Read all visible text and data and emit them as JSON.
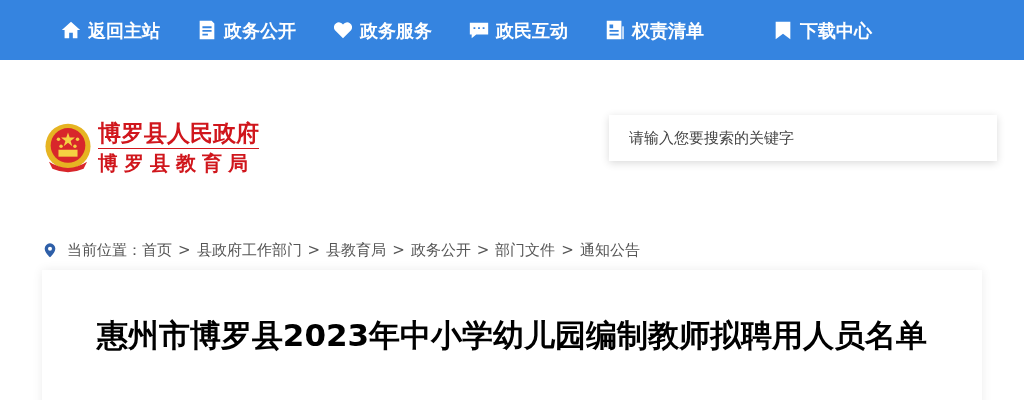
{
  "nav": [
    {
      "label": "返回主站"
    },
    {
      "label": "政务公开"
    },
    {
      "label": "政务服务"
    },
    {
      "label": "政民互动"
    },
    {
      "label": "权责清单"
    },
    {
      "label": "下载中心"
    }
  ],
  "logo": {
    "title": "博罗县人民政府",
    "subtitle": "博罗县教育局"
  },
  "search": {
    "placeholder": "请输入您要搜索的关键字"
  },
  "breadcrumb": {
    "label": "当前位置：",
    "items": [
      "首页",
      "县政府工作部门",
      "县教育局",
      "政务公开",
      "部门文件",
      "通知公告"
    ],
    "separator": ">"
  },
  "article": {
    "title": "惠州市博罗县2023年中小学幼儿园编制教师拟聘用人员名单"
  }
}
